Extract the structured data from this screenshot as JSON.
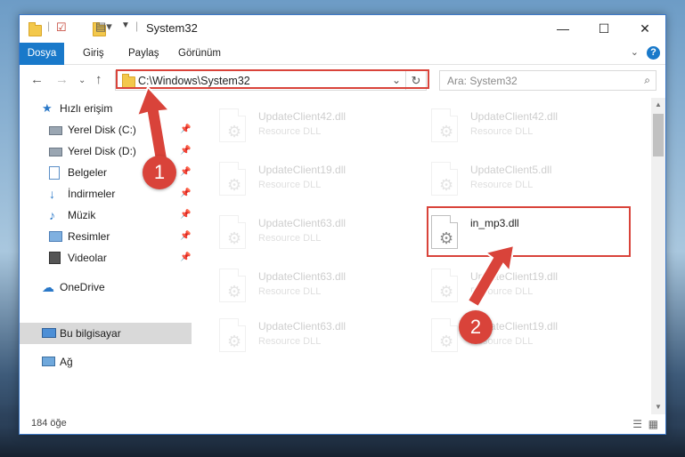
{
  "window": {
    "title": "System32"
  },
  "ribbon": {
    "tabs": [
      "Dosya",
      "Giriş",
      "Paylaş",
      "Görünüm"
    ]
  },
  "address": {
    "path": "C:\\Windows\\System32"
  },
  "search": {
    "placeholder": "Ara: System32"
  },
  "sidebar": {
    "items": [
      {
        "label": "Hızlı erişim",
        "icon": "star-icon",
        "pinned": false
      },
      {
        "label": "Yerel Disk (C:)",
        "icon": "drive-icon",
        "pinned": true
      },
      {
        "label": "Yerel Disk (D:)",
        "icon": "drive-icon",
        "pinned": true
      },
      {
        "label": "Belgeler",
        "icon": "documents-icon",
        "pinned": true
      },
      {
        "label": "İndirmeler",
        "icon": "download-icon",
        "pinned": true
      },
      {
        "label": "Müzik",
        "icon": "music-icon",
        "pinned": true
      },
      {
        "label": "Resimler",
        "icon": "pictures-icon",
        "pinned": true
      },
      {
        "label": "Videolar",
        "icon": "videos-icon",
        "pinned": true
      },
      {
        "label": "OneDrive",
        "icon": "cloud-icon",
        "pinned": false
      },
      {
        "label": "Bu bilgisayar",
        "icon": "computer-icon",
        "pinned": false
      },
      {
        "label": "Ağ",
        "icon": "network-icon",
        "pinned": false
      }
    ]
  },
  "files": [
    {
      "name": "UpdateClient42.dll",
      "type": "Resource DLL",
      "faded": true
    },
    {
      "name": "UpdateClient42.dll",
      "type": "Resource DLL",
      "faded": true
    },
    {
      "name": "UpdateClient19.dll",
      "type": "Resource DLL",
      "faded": true
    },
    {
      "name": "UpdateClient5.dll",
      "type": "Resource DLL",
      "faded": true
    },
    {
      "name": "UpdateClient63.dll",
      "type": "Resource DLL",
      "faded": true
    },
    {
      "name": "in_mp3.dll",
      "type": "",
      "faded": false
    },
    {
      "name": "UpdateClient63.dll",
      "type": "Resource DLL",
      "faded": true
    },
    {
      "name": "UpdateClient19.dll",
      "type": "Resource DLL",
      "faded": true
    },
    {
      "name": "UpdateClient63.dll",
      "type": "Resource DLL",
      "faded": true
    },
    {
      "name": "UpdateClient19.dll",
      "type": "Resource DLL",
      "faded": true
    }
  ],
  "status": {
    "count": "184 öğe"
  },
  "annotations": {
    "step1": "1",
    "step2": "2",
    "color": "#d9433a"
  }
}
